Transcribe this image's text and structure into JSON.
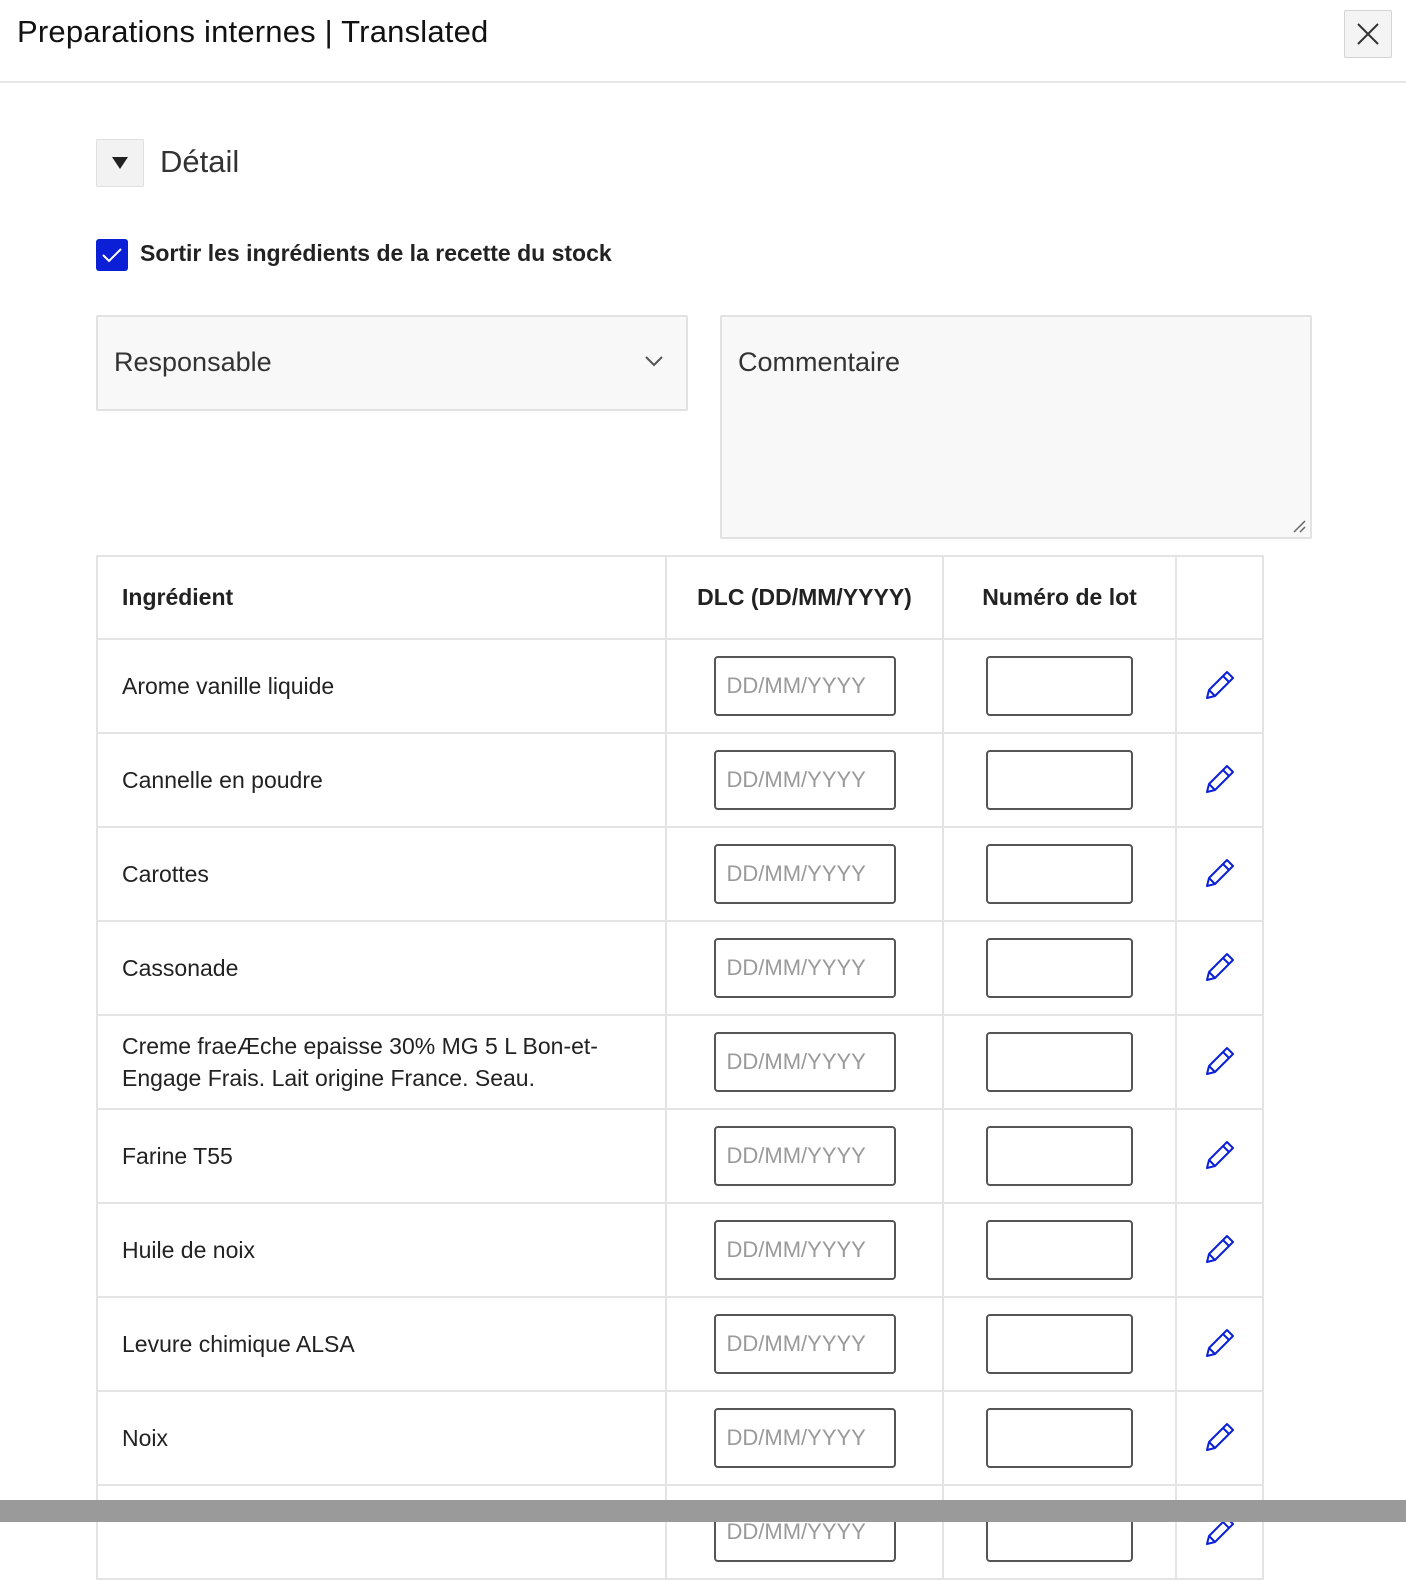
{
  "header": {
    "title": "Preparations internes | Translated"
  },
  "section": {
    "title": "Détail"
  },
  "options": {
    "stock_checkbox_label": "Sortir les ingrédients de la recette du stock",
    "stock_checked": true
  },
  "form": {
    "responsable_label": "Responsable",
    "commentaire_label": "Commentaire"
  },
  "table": {
    "headers": {
      "ingredient": "Ingrédient",
      "dlc": "DLC (DD/MM/YYYY)",
      "lot": "Numéro de lot"
    },
    "date_placeholder": "DD/MM/YYYY",
    "rows": [
      {
        "ingredient": "Arome vanille liquide"
      },
      {
        "ingredient": "Cannelle en poudre"
      },
      {
        "ingredient": "Carottes"
      },
      {
        "ingredient": "Cassonade"
      },
      {
        "ingredient": "Creme fraeÆche epaisse 30% MG 5 L Bon-et-Engage Frais. Lait origine France. Seau."
      },
      {
        "ingredient": "Farine T55"
      },
      {
        "ingredient": "Huile de noix"
      },
      {
        "ingredient": "Levure chimique ALSA"
      },
      {
        "ingredient": "Noix"
      },
      {
        "ingredient": ""
      }
    ]
  },
  "colors": {
    "accent": "#0a1fd6",
    "border": "#e4e4e4",
    "field_bg": "#f8f8f8"
  }
}
